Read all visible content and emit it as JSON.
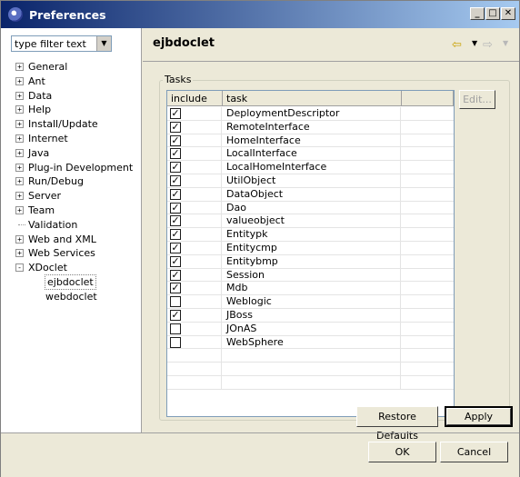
{
  "window": {
    "title": "Preferences"
  },
  "filter": {
    "value": "type filter text"
  },
  "tree": [
    {
      "label": "General",
      "toggle": "+"
    },
    {
      "label": "Ant",
      "toggle": "+"
    },
    {
      "label": "Data",
      "toggle": "+"
    },
    {
      "label": "Help",
      "toggle": "+"
    },
    {
      "label": "Install/Update",
      "toggle": "+"
    },
    {
      "label": "Internet",
      "toggle": "+"
    },
    {
      "label": "Java",
      "toggle": "+"
    },
    {
      "label": "Plug-in Development",
      "toggle": "+"
    },
    {
      "label": "Run/Debug",
      "toggle": "+"
    },
    {
      "label": "Server",
      "toggle": "+"
    },
    {
      "label": "Team",
      "toggle": "+"
    },
    {
      "label": "Validation",
      "toggle": ""
    },
    {
      "label": "Web and XML",
      "toggle": "+"
    },
    {
      "label": "Web Services",
      "toggle": "+"
    },
    {
      "label": "XDoclet",
      "toggle": "−"
    },
    {
      "label": "ejbdoclet",
      "toggle": "",
      "child": true,
      "selected": true
    },
    {
      "label": "webdoclet",
      "toggle": "",
      "child": true
    }
  ],
  "page": {
    "title": "ejbdoclet"
  },
  "nav": {
    "back_icon": "back-arrow-icon",
    "forward_icon": "forward-arrow-icon"
  },
  "tasks": {
    "group_title": "Tasks",
    "columns": [
      "include",
      "task"
    ],
    "rows": [
      {
        "task": "DeploymentDescriptor",
        "include": true
      },
      {
        "task": "RemoteInterface",
        "include": true
      },
      {
        "task": "HomeInterface",
        "include": true
      },
      {
        "task": "LocalInterface",
        "include": true
      },
      {
        "task": "LocalHomeInterface",
        "include": true
      },
      {
        "task": "UtilObject",
        "include": true
      },
      {
        "task": "DataObject",
        "include": true
      },
      {
        "task": "Dao",
        "include": true
      },
      {
        "task": "valueobject",
        "include": true
      },
      {
        "task": "Entitypk",
        "include": true
      },
      {
        "task": "Entitycmp",
        "include": true
      },
      {
        "task": "Entitybmp",
        "include": true
      },
      {
        "task": "Session",
        "include": true
      },
      {
        "task": "Mdb",
        "include": true
      },
      {
        "task": "Weblogic",
        "include": false
      },
      {
        "task": "JBoss",
        "include": true
      },
      {
        "task": "JOnAS",
        "include": false
      },
      {
        "task": "WebSphere",
        "include": false
      },
      {
        "task": "",
        "include": null
      },
      {
        "task": "",
        "include": null
      },
      {
        "task": "",
        "include": null
      }
    ],
    "edit_label": "Edit..."
  },
  "buttons": {
    "restore_defaults": "Restore Defaults",
    "apply": "Apply",
    "ok": "OK",
    "cancel": "Cancel"
  }
}
